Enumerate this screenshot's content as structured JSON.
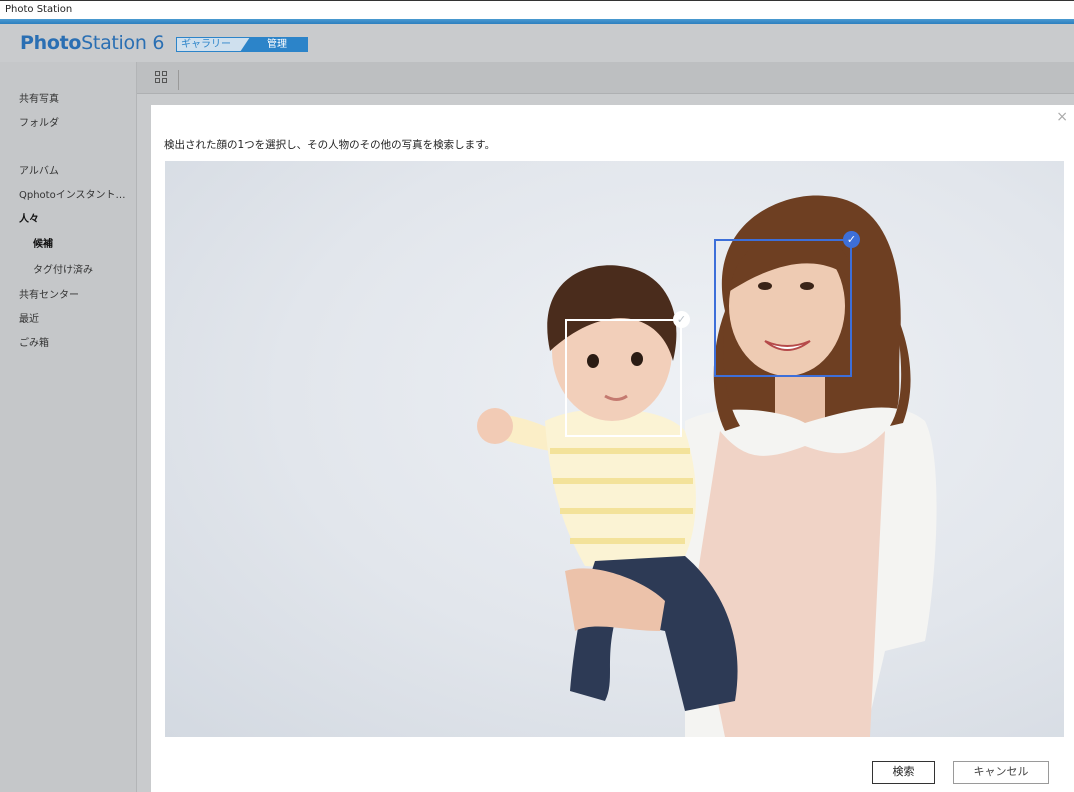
{
  "window": {
    "title": "Photo Station"
  },
  "header": {
    "brand_bold": "Photo",
    "brand_light": "Station 6",
    "mode_gallery": "ギャラリー",
    "mode_manage": "管理"
  },
  "sidebar": {
    "items": [
      {
        "label": "共有写真"
      },
      {
        "label": "フォルダ"
      },
      {
        "label": "アルバム"
      },
      {
        "label": "Qphotoインスタントアップロード"
      },
      {
        "label": "人々"
      },
      {
        "label": "候補"
      },
      {
        "label": "タグ付け済み"
      },
      {
        "label": "共有センター"
      },
      {
        "label": "最近"
      },
      {
        "label": "ごみ箱"
      }
    ]
  },
  "toolbar": {
    "icon": "grid-select-icon"
  },
  "dialog": {
    "close_label": "×",
    "instruction": "検出された顔の1つを選択し、その人物のその他の写真を検索します。",
    "faces": [
      {
        "label": "child-face",
        "selected": false
      },
      {
        "label": "woman-face",
        "selected": true
      }
    ],
    "check_mark": "✓",
    "search_button": "検索",
    "cancel_button": "キャンセル",
    "colors": {
      "selected": "#3d6fd9",
      "unselected": "#ffffff"
    }
  }
}
